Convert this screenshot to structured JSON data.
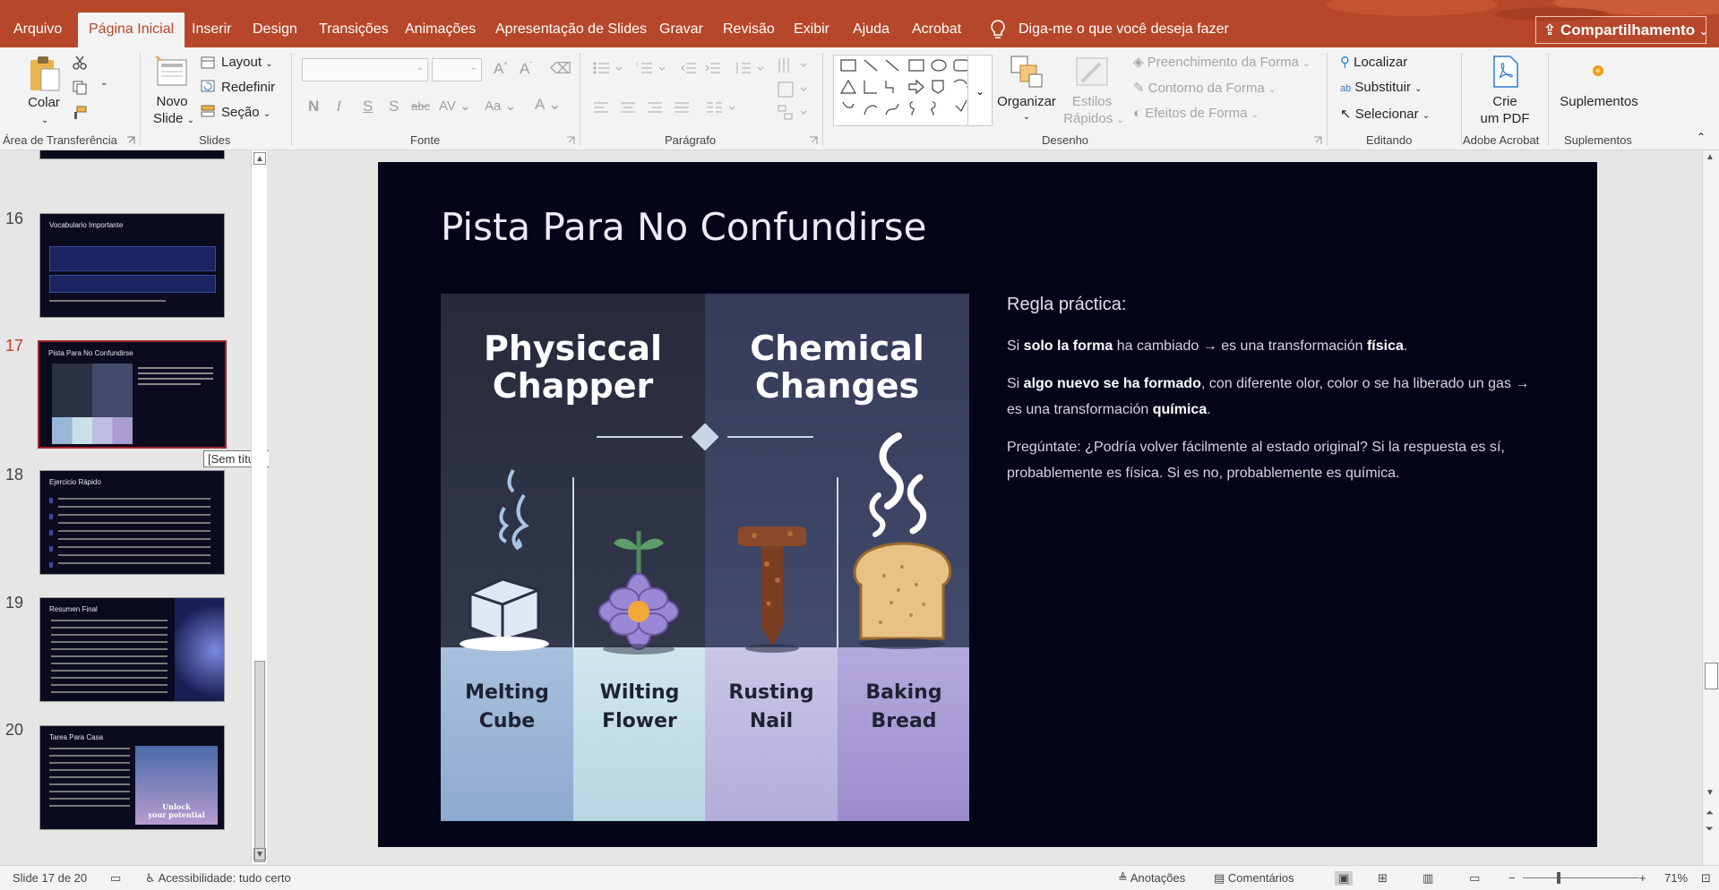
{
  "ribbon_tabs": [
    "Arquivo",
    "Página Inicial",
    "Inserir",
    "Design",
    "Transições",
    "Animações",
    "Apresentação de Slides",
    "Gravar",
    "Revisão",
    "Exibir",
    "Ajuda",
    "Acrobat"
  ],
  "tell_me": "Diga-me o que você deseja fazer",
  "share_label": "Compartilhamento",
  "clipboard": {
    "paste": "Colar",
    "group": "Área de Transferência"
  },
  "slides_group": {
    "new_slide_1": "Novo",
    "new_slide_2": "Slide",
    "layout": "Layout",
    "reset": "Redefinir",
    "section": "Seção",
    "group": "Slides"
  },
  "font_group": {
    "group": "Fonte",
    "font_name": "",
    "font_size": ""
  },
  "paragraph_group": {
    "group": "Parágrafo"
  },
  "drawing_group": {
    "arrange": "Organizar",
    "quick_styles_1": "Estilos",
    "quick_styles_2": "Rápidos",
    "shape_fill": "Preenchimento da Forma",
    "shape_outline": "Contorno da Forma",
    "shape_effects": "Efeitos de Forma",
    "group": "Desenho"
  },
  "editing_group": {
    "find": "Localizar",
    "replace": "Substituir",
    "select": "Selecionar",
    "group": "Editando"
  },
  "acrobat_group": {
    "create_1": "Crie",
    "create_2": "um PDF",
    "group": "Adobe Acrobat"
  },
  "addins_group": {
    "addins": "Suplementos",
    "group": "Suplementos"
  },
  "thumbnails": [
    {
      "number": "16",
      "title": "Vocabulario Importante"
    },
    {
      "number": "17",
      "title": "Pista Para No Confundirse",
      "active": true
    },
    {
      "number": "18",
      "title": "Ejercicio Rápido"
    },
    {
      "number": "19",
      "title": "Resumen Final"
    },
    {
      "number": "20",
      "title": "Tarea Para Casa"
    }
  ],
  "thumb20_text": {
    "line1": "Unlock",
    "line2": "your potential"
  },
  "tooltip": "[Sem título]",
  "slide": {
    "title": "Pista Para No Confundirse",
    "illustration": {
      "left_heading_1": "Physiccal",
      "left_heading_2": "Chapper",
      "right_heading_1": "Chemical",
      "right_heading_2": "Changes",
      "labels": [
        {
          "l1": "Melting",
          "l2": "Cube"
        },
        {
          "l1": "Wilting",
          "l2": "Flower"
        },
        {
          "l1": "Rusting",
          "l2": "Nail"
        },
        {
          "l1": "Baking",
          "l2": "Bread"
        }
      ]
    },
    "rule_heading": "Regla práctica:",
    "p1": {
      "a": "Si ",
      "b": "solo la forma",
      "c": " ha cambiado → es una transformación ",
      "d": "física",
      "e": "."
    },
    "p2": {
      "a": "Si ",
      "b": "algo nuevo se ha formado",
      "c": ", con diferente olor, color o se ha liberado un gas → es una transformación ",
      "d": "química",
      "e": "."
    },
    "p3": "Pregúntate: ¿Podría volver fácilmente al estado original? Si la respuesta es sí, probablemente es física. Si es no, probablemente es química."
  },
  "status": {
    "slide_counter": "Slide 17 de 20",
    "accessibility": "Acessibilidade: tudo certo",
    "notes": "Anotações",
    "comments": "Comentários",
    "zoom": "71%"
  },
  "colors": {
    "ribbon_accent": "#b7472a",
    "slide_bg": "#05051a",
    "active_thumb": "#a4262c"
  }
}
